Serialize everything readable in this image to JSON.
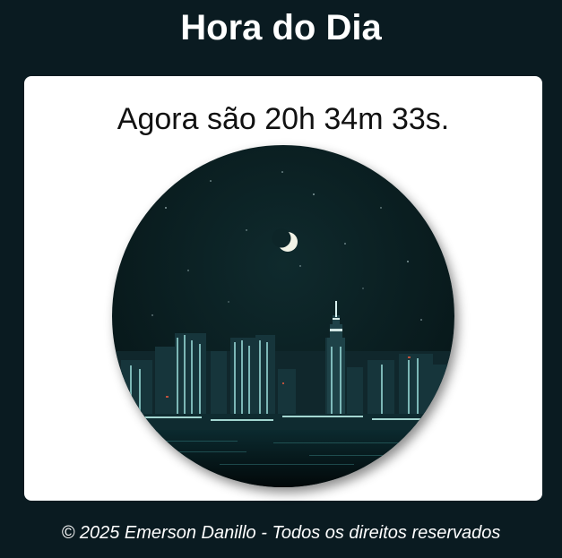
{
  "header": {
    "title": "Hora do Dia"
  },
  "clock": {
    "message": "Agora são 20h 34m 33s."
  },
  "image": {
    "subject": "night-city-skyline-icon"
  },
  "footer": {
    "copyright": "© 2025 Emerson Danillo - Todos os direitos reservados"
  },
  "colors": {
    "background": "#0a1b21",
    "card": "#ffffff",
    "text_light": "#ffffff",
    "text_dark": "#111111"
  }
}
